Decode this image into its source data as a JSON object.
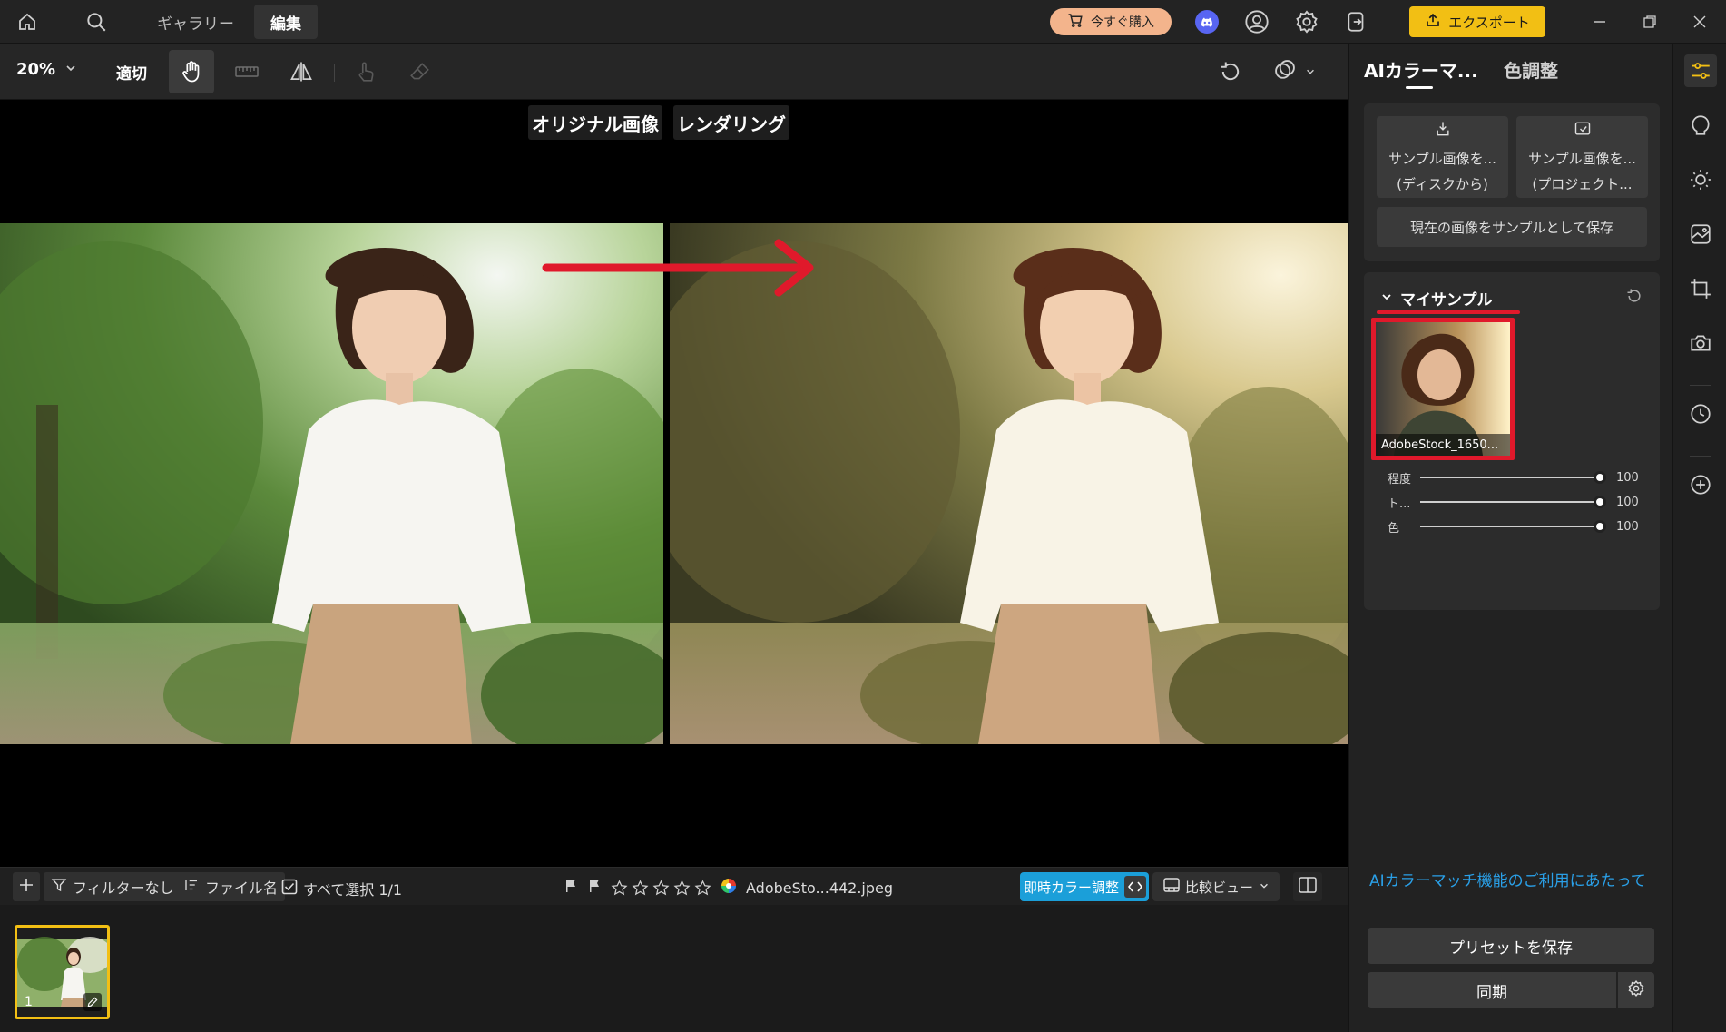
{
  "titlebar": {
    "tabs": [
      {
        "label": "ギャラリー",
        "active": false
      },
      {
        "label": "編集",
        "active": true
      }
    ],
    "buy_label": "今すぐ購入",
    "export_label": "エクスポート",
    "icons": [
      "home-icon",
      "search-icon",
      "discord-icon",
      "account-icon",
      "settings-icon",
      "sign-in-icon"
    ]
  },
  "toolbar": {
    "zoom": "20%",
    "fit_label": "適切"
  },
  "canvas": {
    "original_label": "オリジナル画像",
    "rendered_label": "レンダリング"
  },
  "filmbar": {
    "filter_label": "フィルターなし",
    "sort_label": "ファイル名",
    "select_all_label": "すべて選択 1/1",
    "filename": "AdobeSto...442.jpeg",
    "instant_color_label": "即時カラー調整",
    "compare_view_label": "比較ビュー",
    "rating_stars": 0
  },
  "filmstrip": {
    "thumbs": [
      {
        "index": "1"
      }
    ]
  },
  "panel": {
    "tab_ai": "AIカラーマ...",
    "tab_color": "色調整",
    "sample_disk_line1": "サンプル画像を...",
    "sample_disk_line2": "(ディスクから)",
    "sample_project_line1": "サンプル画像を...",
    "sample_project_line2": "(プロジェクト...",
    "save_current_label": "現在の画像をサンプルとして保存",
    "my_samples_title": "マイサンプル",
    "sample_caption": "AdobeStock_1650...",
    "sliders": [
      {
        "label": "程度",
        "value": "100",
        "fraction": 1.0
      },
      {
        "label": "ト...",
        "value": "100",
        "fraction": 1.0
      },
      {
        "label": "色",
        "value": "100",
        "fraction": 1.0
      }
    ],
    "ai_link": "AIカラーマッチ機能のご利用にあたって",
    "save_preset_label": "プリセットを保存",
    "sync_label": "同期"
  },
  "colors": {
    "accent_yellow": "#f2bf14",
    "highlight_red": "#e0192b",
    "link_blue": "#2aa0e8"
  }
}
